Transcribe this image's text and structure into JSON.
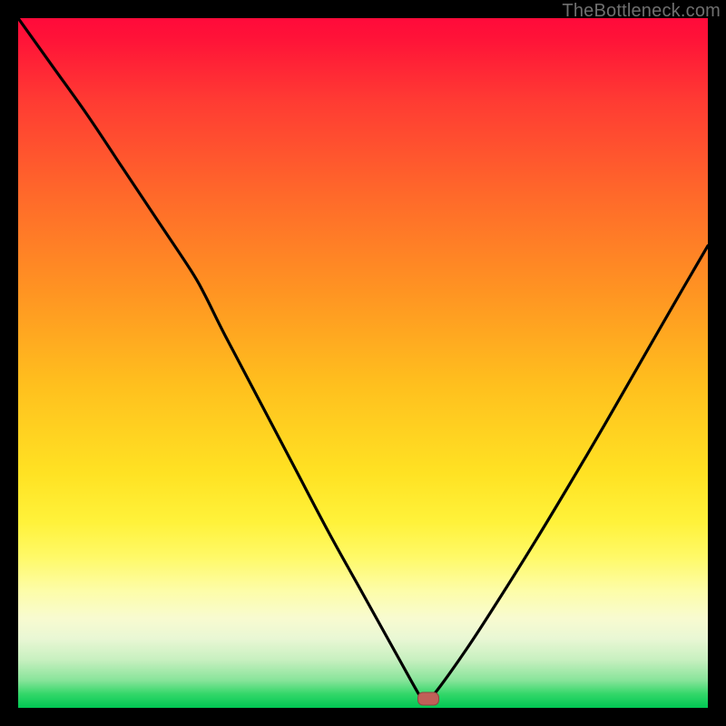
{
  "watermark": "TheBottleneck.com",
  "chart_data": {
    "type": "line",
    "title": "",
    "xlabel": "",
    "ylabel": "",
    "xlim": [
      0,
      100
    ],
    "ylim": [
      0,
      100
    ],
    "grid": false,
    "series": [
      {
        "name": "bottleneck-curve",
        "x": [
          0,
          5,
          10,
          15,
          20,
          25,
          27,
          30,
          35,
          40,
          45,
          50,
          55,
          58.5,
          59,
          60,
          65,
          70,
          75,
          80,
          85,
          90,
          95,
          100
        ],
        "y": [
          100,
          93,
          86,
          78.5,
          71,
          63.5,
          60,
          54,
          44.5,
          35,
          25.5,
          16.5,
          7.5,
          1.3,
          1.3,
          1.6,
          8.5,
          16.2,
          24.2,
          32.5,
          41,
          49.7,
          58.4,
          67
        ]
      }
    ],
    "marker": {
      "x": 59.5,
      "y": 1.3
    },
    "gradient_stops": [
      {
        "pct": 0,
        "color": "#ff0a3a"
      },
      {
        "pct": 26,
        "color": "#ff6a2a"
      },
      {
        "pct": 53,
        "color": "#ffbf1e"
      },
      {
        "pct": 78,
        "color": "#fff966"
      },
      {
        "pct": 100,
        "color": "#00c853"
      }
    ]
  }
}
